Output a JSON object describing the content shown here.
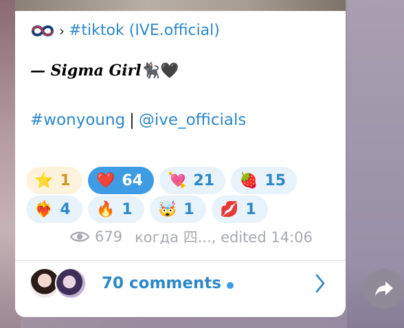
{
  "post": {
    "sep": "›",
    "tag_source": "#tiktok (IVE.official)",
    "title_line": "— Sigma Girl",
    "title_emoji": "🐈‍⬛🖤",
    "hashtag": "#wonyoung",
    "pipe": "|",
    "mention": "@ive_officials"
  },
  "reactions": [
    {
      "emoji": "⭐",
      "count": "1"
    },
    {
      "emoji": "❤️",
      "count": "64"
    },
    {
      "emoji": "💘",
      "count": "21"
    },
    {
      "emoji": "🍓",
      "count": "15"
    },
    {
      "emoji": "❤️‍🔥",
      "count": "4"
    },
    {
      "emoji": "🔥",
      "count": "1"
    },
    {
      "emoji": "🤯",
      "count": "1"
    },
    {
      "emoji": "💋",
      "count": "1"
    }
  ],
  "meta": {
    "views": "679",
    "author_edit": "когда 四..., edited 14:06"
  },
  "comments": {
    "label": "70 comments"
  },
  "colors": {
    "link": "#2c87c9",
    "active_reaction": "#3d9ce3"
  }
}
